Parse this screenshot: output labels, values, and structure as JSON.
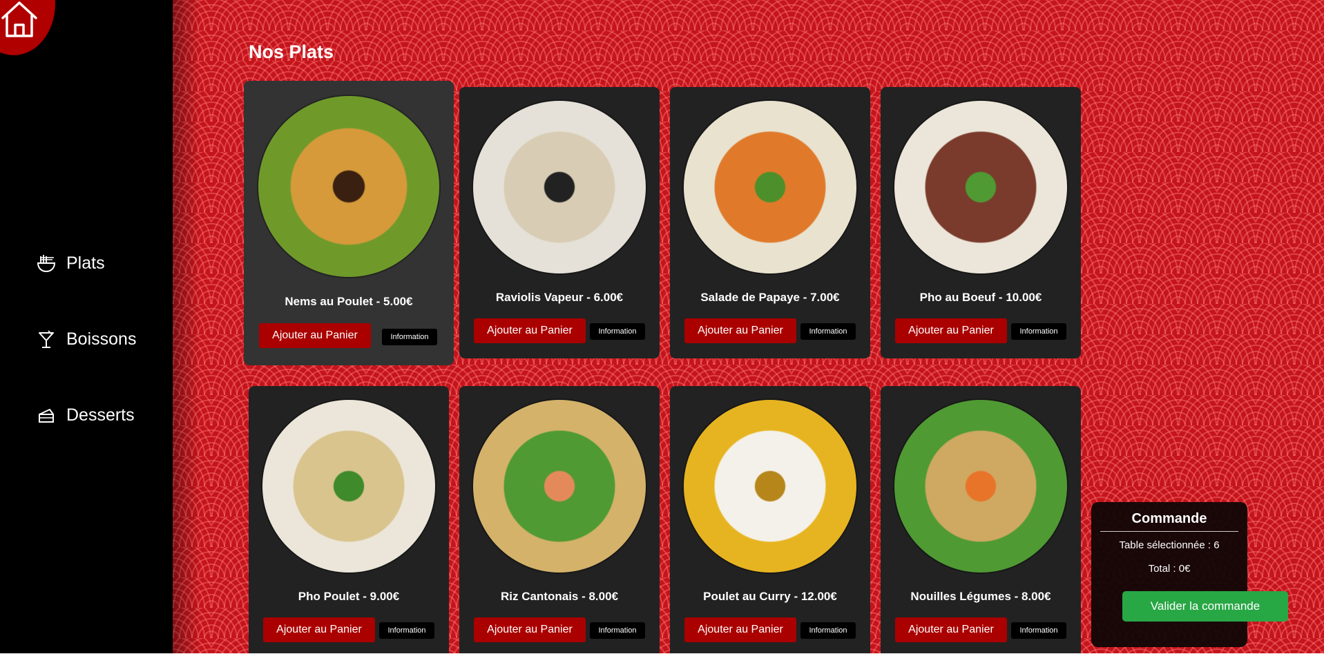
{
  "header": {
    "title": "Nos Plats"
  },
  "sidebar": {
    "items": [
      {
        "label": "Plats",
        "icon": "noodle-bowl-icon"
      },
      {
        "label": "Boissons",
        "icon": "cocktail-icon"
      },
      {
        "label": "Desserts",
        "icon": "cake-icon"
      }
    ]
  },
  "buttons": {
    "add": "Ajouter au Panier",
    "info": "Information"
  },
  "dishes": [
    {
      "name": "Nems au Poulet - 5.00€",
      "image": "spring-rolls-plate",
      "colors": [
        "#6f9a2a",
        "#d69a3a",
        "#3a2010"
      ]
    },
    {
      "name": "Raviolis Vapeur - 6.00€",
      "image": "steamed-dumplings-plate",
      "colors": [
        "#e5e1d8",
        "#d8cdb4",
        "#222"
      ]
    },
    {
      "name": "Salade de Papaye - 7.00€",
      "image": "papaya-salad-plate",
      "colors": [
        "#e9e2cf",
        "#e07a2a",
        "#4d8f2a"
      ]
    },
    {
      "name": "Pho au Boeuf - 10.00€",
      "image": "beef-pho-bowl",
      "colors": [
        "#ece6da",
        "#7a3b2c",
        "#4f9a33"
      ]
    },
    {
      "name": "Pho Poulet - 9.00€",
      "image": "chicken-pho-bowl",
      "colors": [
        "#ece6da",
        "#d9c48e",
        "#3f8a2a"
      ]
    },
    {
      "name": "Riz Cantonais - 8.00€",
      "image": "fried-rice-plate",
      "colors": [
        "#d4b26a",
        "#4f9a33",
        "#e48a5a"
      ]
    },
    {
      "name": "Poulet au Curry - 12.00€",
      "image": "chicken-curry-plate",
      "colors": [
        "#e7b421",
        "#f4f1ea",
        "#b6861a"
      ]
    },
    {
      "name": "Nouilles Légumes - 8.00€",
      "image": "vegetable-noodles-bowl",
      "colors": [
        "#4f9a33",
        "#cfa862",
        "#e8742a"
      ]
    }
  ],
  "order": {
    "title": "Commande",
    "table": "Table sélectionnée : 6",
    "total": "Total : 0€",
    "validate": "Valider la commande"
  },
  "colors": {
    "sidebar": "#000000",
    "background": "#c4141c",
    "card": "#222222",
    "add_button": "#aa0000",
    "validate_button": "#28a745"
  }
}
